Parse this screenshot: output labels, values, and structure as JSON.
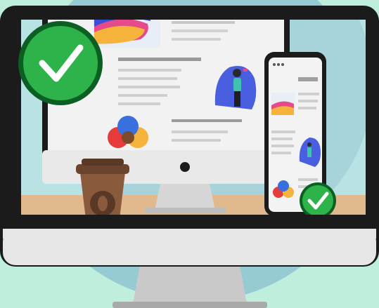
{
  "scene": {
    "colors": {
      "background": "#bfefdc",
      "bg_circle": "#96cbd3",
      "monitor_bezel": "#1b1b1b",
      "monitor_chin": "#e6e6e6",
      "stand": "#c9c9c9",
      "screen_wall": "#b9e2e4",
      "screen_wall_circle": "#a6d4da",
      "desk": "#e1b98c",
      "check_green": "#2db34a",
      "check_ring": "#0c5f22",
      "coffee_cup": "#8a5a3c",
      "coffee_lid": "#6b4430"
    },
    "icons": {
      "large_check": "check-circle-icon",
      "small_check": "check-circle-icon",
      "coffee": "coffee-cup-icon",
      "phone": "smartphone-icon",
      "desktop": "desktop-monitor-icon"
    }
  }
}
